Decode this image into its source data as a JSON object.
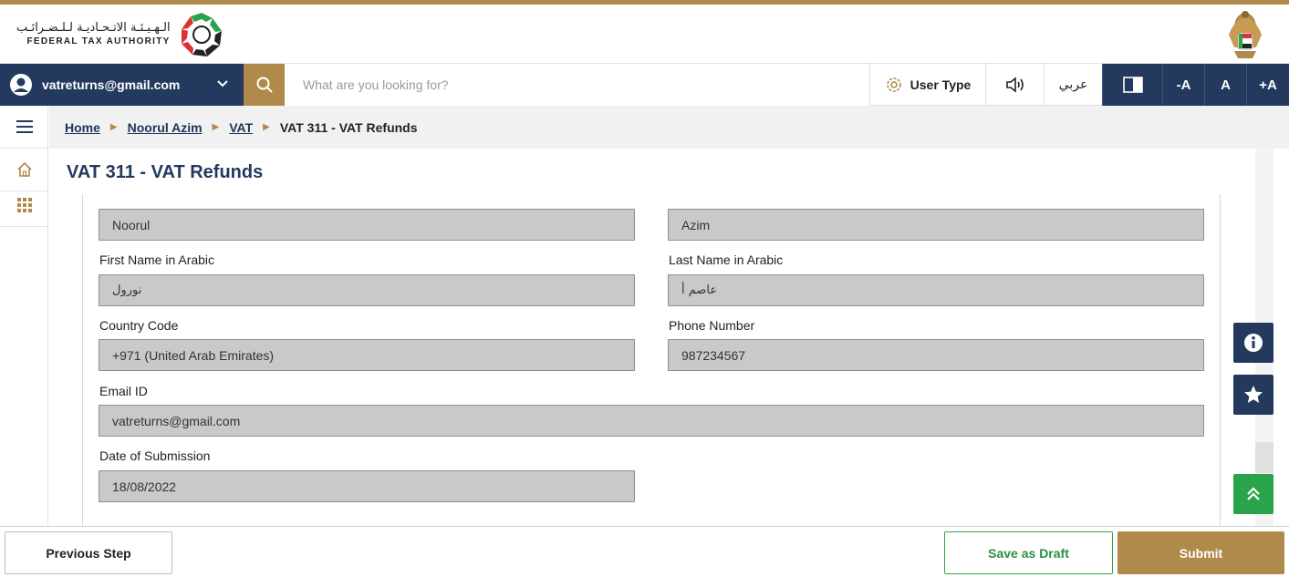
{
  "header": {
    "logo_arabic": "الـهـيـئـة الاتـحـاديـة لـلـضـرائـب",
    "logo_english": "FEDERAL TAX AUTHORITY"
  },
  "navbar": {
    "user_email": "vatreturns@gmail.com",
    "search_placeholder": "What are you looking for?",
    "user_type_label": "User Type",
    "language_label": "عربي",
    "font_small": "-A",
    "font_normal": "A",
    "font_large": "+A"
  },
  "breadcrumb": {
    "home": "Home",
    "taxpayer": "Noorul Azim",
    "tax": "VAT",
    "current": "VAT 311 - VAT Refunds"
  },
  "page": {
    "title": "VAT 311 - VAT Refunds"
  },
  "form": {
    "first_name_value": "Noorul",
    "last_name_value": "Azim",
    "first_name_ar_label": "First Name in Arabic",
    "first_name_ar_value": "نورول",
    "last_name_ar_label": "Last Name in Arabic",
    "last_name_ar_value": "عاصم أ",
    "country_code_label": "Country Code",
    "country_code_value": "+971 (United Arab Emirates)",
    "phone_label": "Phone Number",
    "phone_value": "987234567",
    "email_label": "Email ID",
    "email_value": "vatreturns@gmail.com",
    "date_label": "Date of Submission",
    "date_value": "18/08/2022"
  },
  "footer": {
    "previous_label": "Previous Step",
    "draft_label": "Save as Draft",
    "submit_label": "Submit"
  },
  "colors": {
    "navy": "#233a5e",
    "gold": "#b08a4a",
    "green": "#2aa44a",
    "field_bg": "#c9c9c9"
  }
}
